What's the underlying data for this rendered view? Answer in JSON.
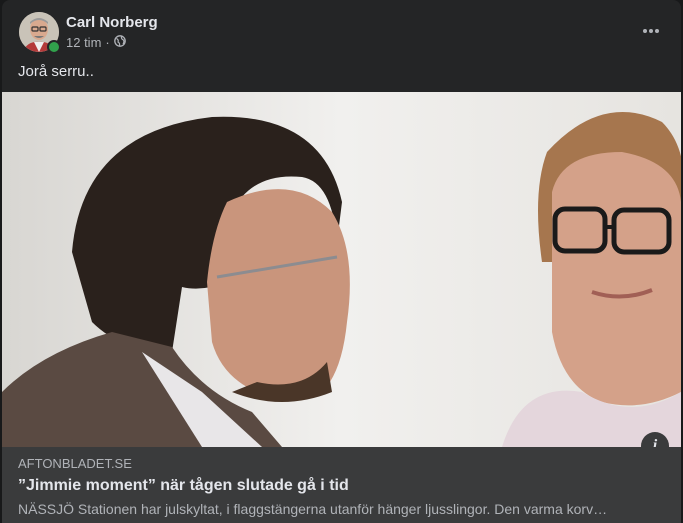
{
  "post": {
    "author": "Carl Norberg",
    "time": "12 tim",
    "separator": "·",
    "audience_icon": "globe-icon",
    "more_icon": "more-options-icon",
    "message": "Jorå serru.."
  },
  "link": {
    "domain": "AFTONBLADET.SE",
    "headline": "”Jimmie moment” när tågen slutade gå i tid",
    "description": "NÄSSJÖ Stationen har julskyltat, i flaggstängerna utanför hänger ljusslingor. Den varma korv…",
    "info_icon": "info-icon",
    "info_label": "i"
  },
  "colors": {
    "card_bg": "#242526",
    "link_bg": "#3a3b3c",
    "primary_text": "#e4e6eb",
    "secondary_text": "#b0b3b8",
    "online": "#31a24c"
  }
}
